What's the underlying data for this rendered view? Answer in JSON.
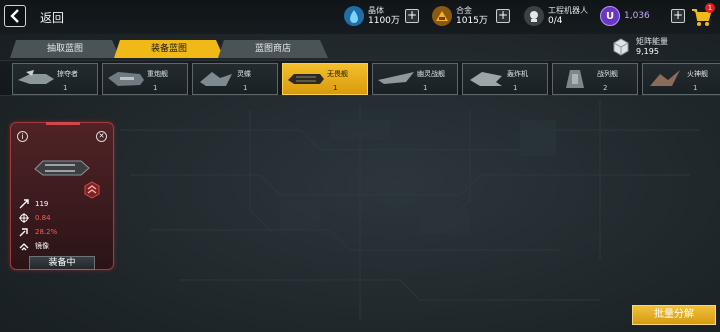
{
  "nav": {
    "back_label": "返回"
  },
  "resources": [
    {
      "name": "晶体",
      "value": "1100万",
      "icon": "crystal-icon",
      "color": "#35a7e8"
    },
    {
      "name": "合金",
      "value": "1015万",
      "icon": "alloy-icon",
      "color": "#f0a020"
    },
    {
      "name": "工程机器人",
      "value": "0/4",
      "icon": "engineer-robot-icon",
      "color": "#d9dfe2"
    }
  ],
  "premium": {
    "value": "1,036",
    "icon": "u-coin-icon",
    "color": "#8a4fe0"
  },
  "cart": {
    "badge": "1",
    "icon": "cart-icon"
  },
  "tabs": [
    {
      "label": "抽取蓝图",
      "active": false
    },
    {
      "label": "装备蓝图",
      "active": true
    },
    {
      "label": "蓝图商店",
      "active": false
    }
  ],
  "matrix_energy": {
    "label": "矩阵能量",
    "value": "9,195",
    "icon": "matrix-cube-icon"
  },
  "ships": [
    {
      "name": "掠夺者",
      "count": "1",
      "active": false
    },
    {
      "name": "重炮舰",
      "count": "1",
      "active": false
    },
    {
      "name": "灵蝶",
      "count": "1",
      "active": false
    },
    {
      "name": "无畏舰",
      "count": "1",
      "active": true
    },
    {
      "name": "幽灵战舰",
      "count": "1",
      "active": false
    },
    {
      "name": "轰炸机",
      "count": "1",
      "active": false
    },
    {
      "name": "战列舰",
      "count": "2",
      "active": false
    },
    {
      "name": "火神舰",
      "count": "1",
      "active": false
    }
  ],
  "card": {
    "stats": [
      {
        "icon": "attack-icon",
        "value": "119",
        "color": "#ffffff"
      },
      {
        "icon": "crosshair-icon",
        "value": "0.84",
        "color": "#ff5a5a"
      },
      {
        "icon": "crit-icon",
        "value": "28.2%",
        "color": "#ff5a5a"
      },
      {
        "icon": "mirror-icon",
        "value": "镜像",
        "color": "#ffffff"
      }
    ],
    "status": "装备中"
  },
  "batch_button": "批量分解",
  "colors": {
    "accent": "#f0b918",
    "card_border": "#a23c3c"
  }
}
